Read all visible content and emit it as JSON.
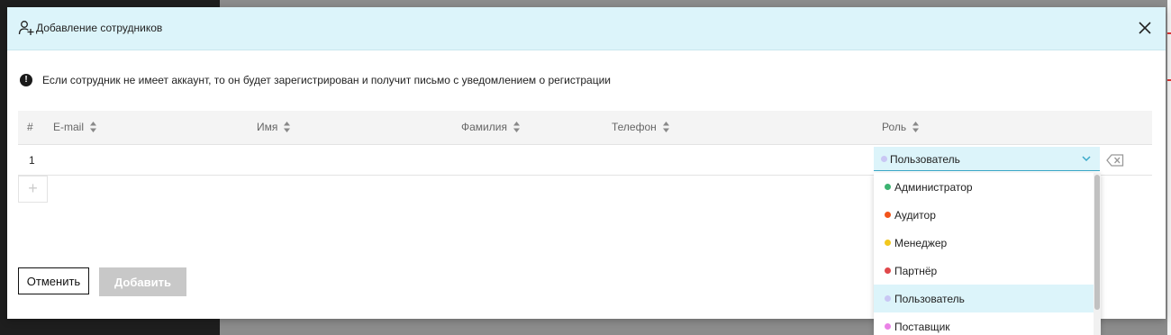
{
  "dialog": {
    "title": "Добавление сотрудников",
    "info": "Если сотрудник не имеет аккаунт, то он будет зарегистрирован и получит письмо с уведомлением о регистрации",
    "icons": {
      "header": "add-user-icon",
      "close": "close-icon",
      "info": "exclamation-circle-icon"
    }
  },
  "table": {
    "columns": [
      "#",
      "E-mail",
      "Имя",
      "Фамилия",
      "Телефон",
      "Роль"
    ],
    "rows": [
      {
        "num": "1",
        "role": "Пользователь"
      }
    ],
    "add_row_label": "+"
  },
  "role_select": {
    "value": "Пользователь",
    "value_color": "#c9c7f4",
    "options": [
      {
        "label": "Администратор",
        "color": "#3cb371"
      },
      {
        "label": "Аудитор",
        "color": "#f2541b"
      },
      {
        "label": "Менеджер",
        "color": "#f2c81e"
      },
      {
        "label": "Партнёр",
        "color": "#e0484b"
      },
      {
        "label": "Пользователь",
        "color": "#c9c7f4"
      },
      {
        "label": "Поставщик",
        "color": "#ea82e6"
      }
    ]
  },
  "buttons": {
    "cancel": "Отменить",
    "add": "Добавить"
  },
  "colors": {
    "header_bg": "#dcf4fa",
    "accent": "#3aa9c9",
    "disabled_btn": "#c8c8c8"
  }
}
